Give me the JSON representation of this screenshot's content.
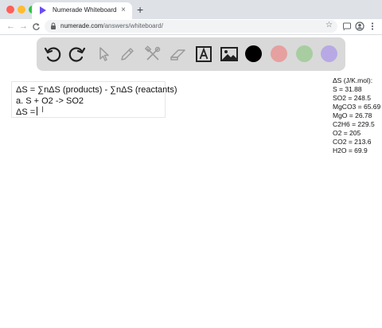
{
  "browser": {
    "tab_title": "Numerade Whiteboard",
    "tab_close": "×",
    "new_tab": "+",
    "url_host": "numerade.com",
    "url_path": "/answers/whiteboard/",
    "nav_back": "←",
    "nav_forward": "→",
    "nav_reload": "C",
    "bookmark_star": "☆"
  },
  "whiteboard": {
    "tools": [
      "undo",
      "redo",
      "select",
      "pen",
      "tools",
      "eraser",
      "text",
      "image"
    ],
    "colors": [
      "#000000",
      "#e6a0a0",
      "#a7cda1",
      "#b8a9e4"
    ]
  },
  "textbox": {
    "line1": "ΔS = ∑nΔS (products) - ∑nΔS (reactants)",
    "line2": "a. S + O2 -> SO2",
    "line3": "ΔS =",
    "cursor": "I"
  },
  "reference": {
    "header": "ΔS (J/K.mol):",
    "items": [
      "S = 31.88",
      "SO2 = 248.5",
      "MgCO3 = 65.69",
      "MgO = 26.78",
      "C2H6 = 229.5",
      "O2 = 205",
      "CO2 = 213.6",
      "H2O = 69.9"
    ]
  }
}
